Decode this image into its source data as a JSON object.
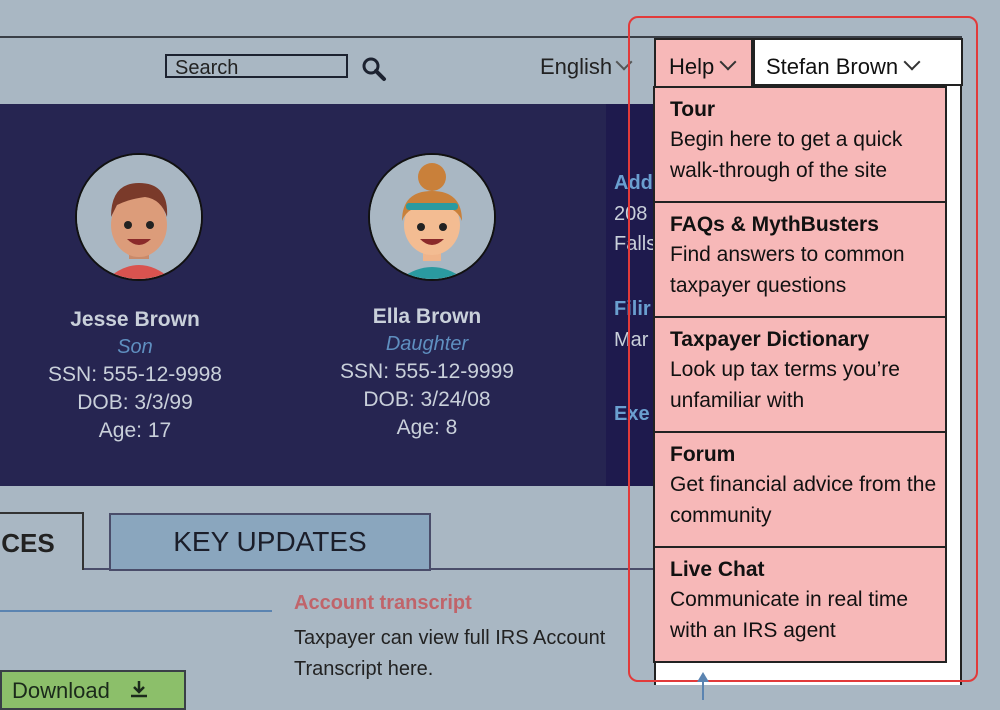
{
  "header": {
    "search_placeholder": "Search",
    "language": "English",
    "help_label": "Help",
    "user_name": "Stefan Brown"
  },
  "family": [
    {
      "name": "Jesse Brown",
      "relation": "Son",
      "ssn": "SSN: 555-12-9998",
      "dob": "DOB: 3/3/99",
      "age": "Age: 17"
    },
    {
      "name": "Ella Brown",
      "relation": "Daughter",
      "ssn": "SSN: 555-12-9999",
      "dob": "DOB: 3/24/08",
      "age": "Age: 8"
    }
  ],
  "partial_info": {
    "address_label": "Add",
    "address_line1": "208",
    "address_line2": "Falls",
    "filing_label": "Filir",
    "filing_value": "Mar",
    "exemptions_label": "Exe"
  },
  "tabs": {
    "services": "ICES",
    "key_updates": "KEY UPDATES"
  },
  "account": {
    "title": "Account transcript",
    "description": "Taxpayer can view full IRS Account Transcript here."
  },
  "download_label": "Download",
  "help_menu": [
    {
      "title": "Tour",
      "desc": "Begin here to get a quick walk-through of the site"
    },
    {
      "title": "FAQs & MythBusters",
      "desc": "Find answers to common taxpayer questions"
    },
    {
      "title": "Taxpayer Dictionary",
      "desc": "Look up tax terms you’re unfamiliar with"
    },
    {
      "title": "Forum",
      "desc": "Get financial advice from the community"
    },
    {
      "title": "Live Chat",
      "desc": "Communicate in real time with an IRS agent"
    }
  ],
  "colors": {
    "accent_red": "#e23a3a",
    "menu_bg": "#f7b8b8",
    "hero_bg": "#262551",
    "download_green": "#8cbf6a"
  }
}
